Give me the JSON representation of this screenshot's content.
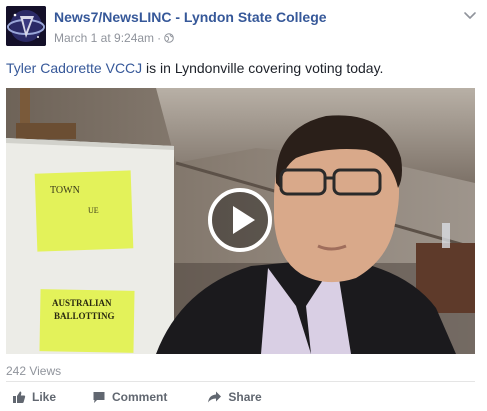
{
  "post": {
    "page_name": "News7/NewsLINC - Lyndon State College",
    "timestamp": "March 1 at 9:24am",
    "separator": "·",
    "message_tag": "Tyler Cadorette VCCJ",
    "message_text": " is in Lyndonville covering voting today.",
    "views": "242 Views",
    "actions": {
      "like": "Like",
      "comment": "Comment",
      "share": "Share"
    }
  },
  "video_scene": {
    "sign_top_lines": [
      "TOWN",
      "UE"
    ],
    "sign_bottom_lines": [
      "AUSTRALIAN",
      "BALLOTTING"
    ]
  },
  "colors": {
    "link": "#365899",
    "meta": "#90949c",
    "action": "#616770"
  },
  "icons": [
    "logo-avatar",
    "chevron-down-icon",
    "globe-icon",
    "play-icon",
    "like-icon",
    "comment-icon",
    "share-icon"
  ]
}
